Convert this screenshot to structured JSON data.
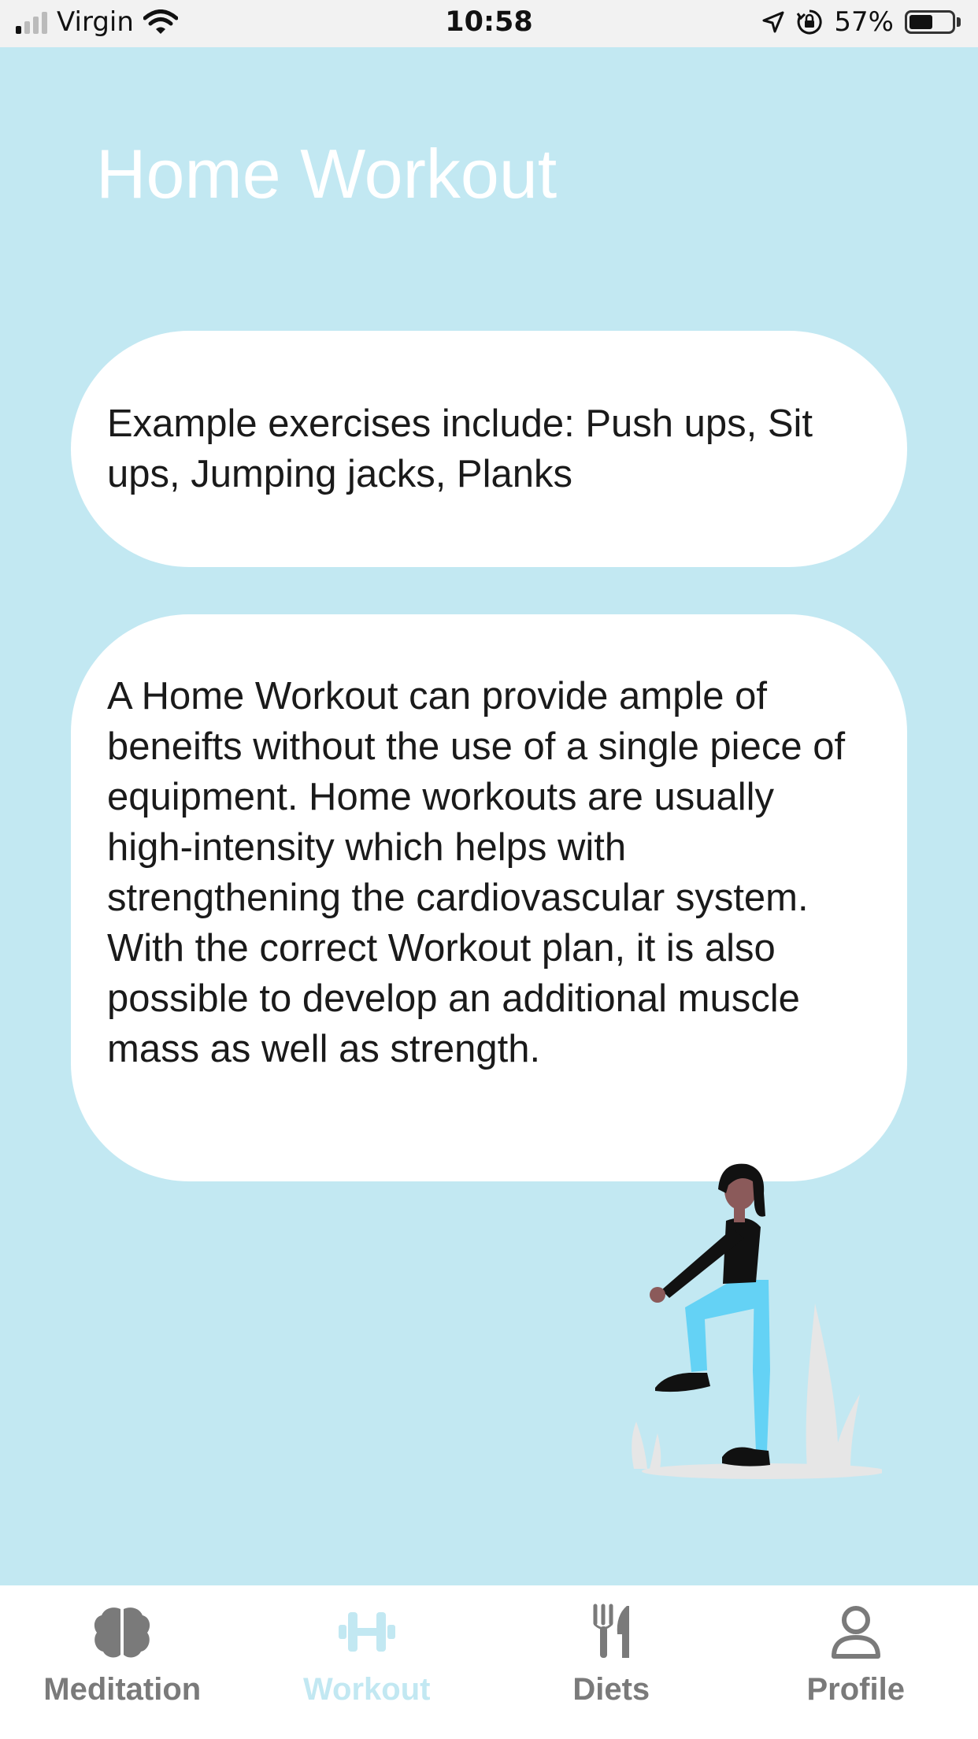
{
  "status_bar": {
    "carrier": "Virgin",
    "time": "10:58",
    "battery": "57%",
    "battery_level": 0.57
  },
  "page": {
    "title": "Home Workout"
  },
  "cards": [
    {
      "text": "Example exercises include: Push ups, Sit ups, Jumping jacks, Planks"
    },
    {
      "text": "A Home Workout can provide ample of beneifts without the use of a single piece of equipment. Home workouts are usually high-intensity which helps with strengthening the cardiovascular system. With the correct Workout plan, it is also possible to develop an additional muscle mass as well as strength."
    }
  ],
  "tab_bar": {
    "tabs": [
      {
        "label": "Meditation",
        "icon": "brain-icon",
        "active": false
      },
      {
        "label": "Workout",
        "icon": "dumbbell-icon",
        "active": true
      },
      {
        "label": "Diets",
        "icon": "fork-knife-icon",
        "active": false
      },
      {
        "label": "Profile",
        "icon": "person-icon",
        "active": false
      }
    ]
  },
  "colors": {
    "background": "#c2e8f2",
    "card": "#ffffff",
    "active_tab": "#c2e8f2",
    "inactive_tab": "#7a7a7a",
    "legging_blue": "#64d2f5"
  }
}
